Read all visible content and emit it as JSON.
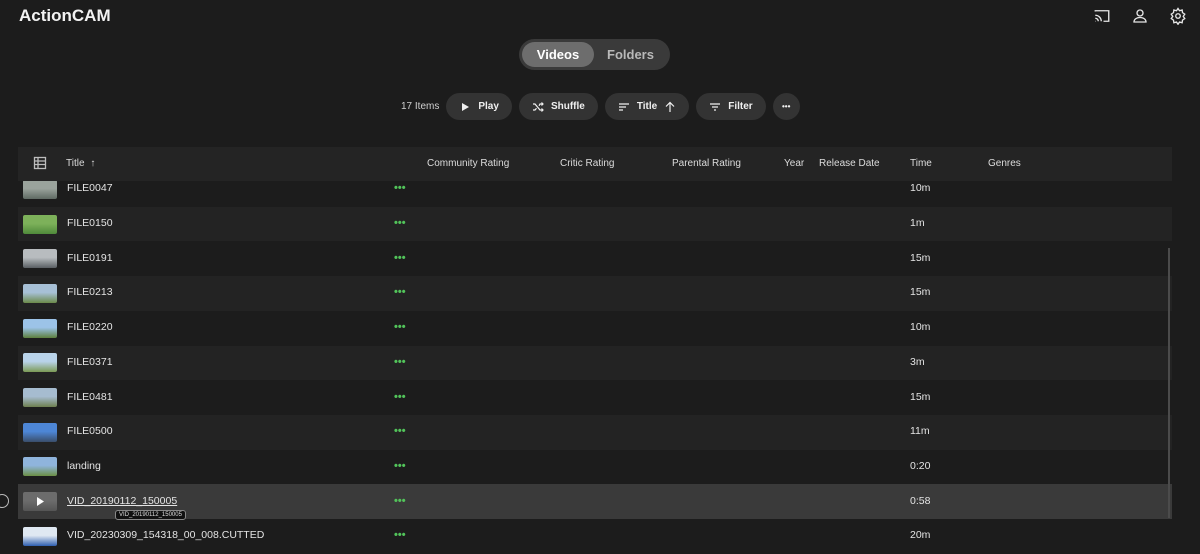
{
  "app": {
    "title": "ActionCAM"
  },
  "topbar": {
    "icons": [
      "cast-icon",
      "user-icon",
      "settings-icon"
    ]
  },
  "view_toggle": {
    "tabs": [
      "Videos",
      "Folders"
    ],
    "active": "Videos"
  },
  "toolbar": {
    "item_count": "17 Items",
    "play_label": "Play",
    "shuffle_label": "Shuffle",
    "sort_label": "Title",
    "filter_label": "Filter",
    "more_label": "•••"
  },
  "table": {
    "columns": {
      "title": "Title",
      "community_rating": "Community Rating",
      "critic_rating": "Critic Rating",
      "parental_rating": "Parental Rating",
      "year": "Year",
      "release_date": "Release Date",
      "time": "Time",
      "genres": "Genres"
    },
    "more_label": "•••",
    "rows": [
      {
        "title": "FILE0047",
        "time": "10m",
        "thumb": [
          "#9aa39c",
          "#5f6a63"
        ]
      },
      {
        "title": "FILE0150",
        "time": "1m",
        "thumb": [
          "#7db15a",
          "#4f8a3a"
        ]
      },
      {
        "title": "FILE0191",
        "time": "15m",
        "thumb": [
          "#b8bcbf",
          "#5a5f63"
        ]
      },
      {
        "title": "FILE0213",
        "time": "15m",
        "thumb": [
          "#a7c0d6",
          "#6b8a4a"
        ]
      },
      {
        "title": "FILE0220",
        "time": "10m",
        "thumb": [
          "#9cc3e8",
          "#5d7f3e"
        ]
      },
      {
        "title": "FILE0371",
        "time": "3m",
        "thumb": [
          "#b9d3ea",
          "#7b9a55"
        ]
      },
      {
        "title": "FILE0481",
        "time": "15m",
        "thumb": [
          "#a6bcd0",
          "#6e7f50"
        ]
      },
      {
        "title": "FILE0500",
        "time": "11m",
        "thumb": [
          "#4d86d6",
          "#3a4e6a"
        ]
      },
      {
        "title": "landing",
        "time": "0:20",
        "thumb": [
          "#8fb4dc",
          "#6b8f45"
        ]
      },
      {
        "title": "VID_20190112_150005",
        "time": "0:58",
        "thumb": [
          "#6c6c6c",
          "#555555"
        ]
      },
      {
        "title": "VID_20230309_154318_00_008.CUTTED",
        "time": "20m",
        "thumb": [
          "#dfe8f2",
          "#2f5fb0"
        ]
      }
    ]
  },
  "tooltip": {
    "text": "VID_20190112_150005"
  }
}
